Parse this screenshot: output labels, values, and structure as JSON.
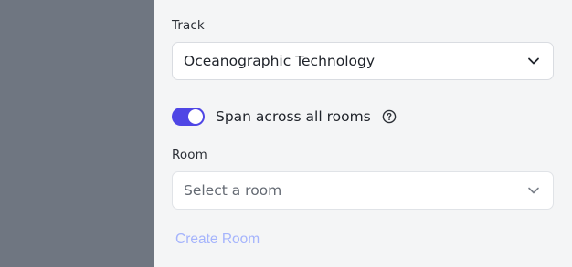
{
  "track": {
    "label": "Track",
    "value": "Oceanographic Technology",
    "icon": "chevron-down-icon"
  },
  "span_toggle": {
    "label": "Span across all rooms",
    "on": true,
    "accent_color": "#4f46e5",
    "help_icon": "question-circle-icon"
  },
  "room": {
    "label": "Room",
    "placeholder": "Select a room",
    "icon": "chevron-down-icon"
  },
  "actions": {
    "create_label": "Create Room",
    "create_color": "#a5b4fc"
  }
}
